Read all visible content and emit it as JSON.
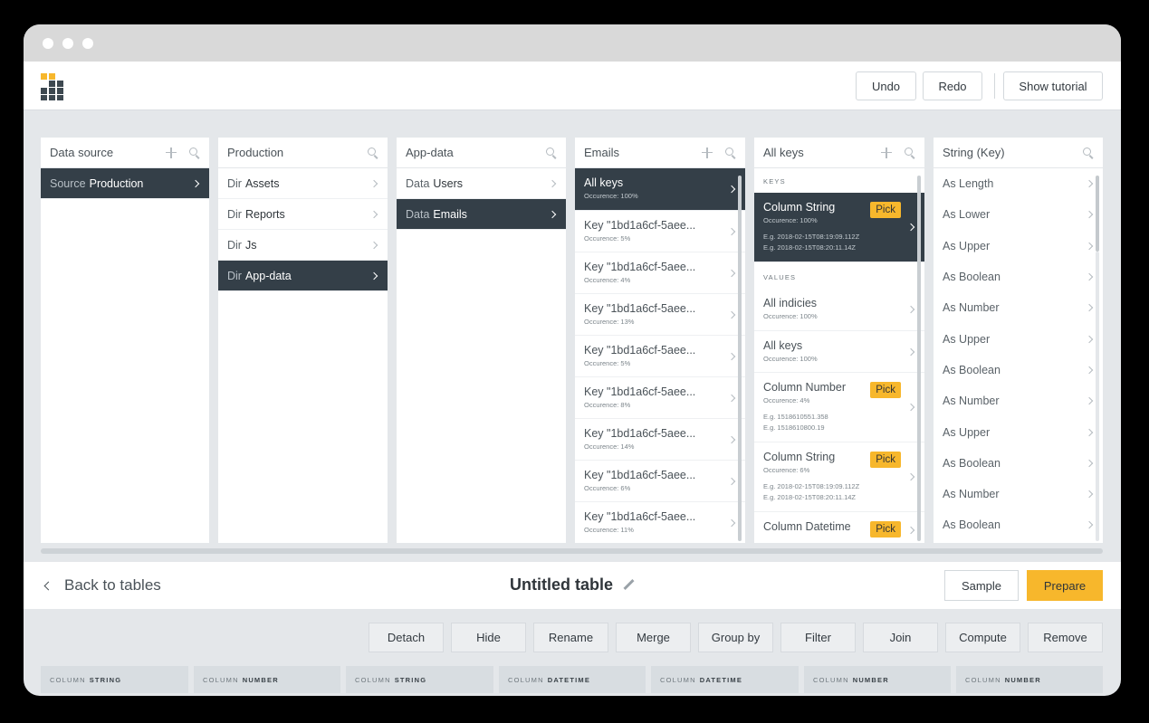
{
  "toolbar": {
    "undo": "Undo",
    "redo": "Redo",
    "tutorial": "Show tutorial"
  },
  "colors": {
    "accent": "#f7b72c",
    "active_row": "#343f48",
    "logo_dark": "#3d4850"
  },
  "columns": [
    {
      "title": "Data source",
      "rows": [
        {
          "prefix": "Source",
          "name": "Production",
          "active": true
        }
      ]
    },
    {
      "title": "Production",
      "rows": [
        {
          "prefix": "Dir",
          "name": "Assets"
        },
        {
          "prefix": "Dir",
          "name": "Reports"
        },
        {
          "prefix": "Dir",
          "name": "Js"
        },
        {
          "prefix": "Dir",
          "name": "App-data",
          "active": true
        }
      ]
    },
    {
      "title": "App-data",
      "rows": [
        {
          "prefix": "Data",
          "name": "Users"
        },
        {
          "prefix": "Data",
          "name": "Emails",
          "active": true
        }
      ]
    },
    {
      "title": "Emails",
      "rows": [
        {
          "main": "All keys",
          "occ": "Occurence: 100%",
          "active": true
        },
        {
          "main": "Key \"1bd1a6cf-5aee...",
          "occ": "Occurence: 5%"
        },
        {
          "main": "Key \"1bd1a6cf-5aee...",
          "occ": "Occurence: 4%"
        },
        {
          "main": "Key \"1bd1a6cf-5aee...",
          "occ": "Occurence: 13%"
        },
        {
          "main": "Key \"1bd1a6cf-5aee...",
          "occ": "Occurence: 5%"
        },
        {
          "main": "Key \"1bd1a6cf-5aee...",
          "occ": "Occurence: 8%"
        },
        {
          "main": "Key \"1bd1a6cf-5aee...",
          "occ": "Occurence: 14%"
        },
        {
          "main": "Key \"1bd1a6cf-5aee...",
          "occ": "Occurence: 6%"
        },
        {
          "main": "Key \"1bd1a6cf-5aee...",
          "occ": "Occurence: 11%"
        }
      ]
    },
    {
      "title": "All keys",
      "keys_label": "KEYS",
      "values_label": "VALUES",
      "pick_label": "Pick",
      "key_rows": [
        {
          "prefix": "Column",
          "name": "String",
          "occ": "Occurence: 100%",
          "eg1": "E.g. 2018-02-15T08:19:09.112Z",
          "eg2": "E.g. 2018-02-15T08:20:11.14Z",
          "pick": true,
          "active": true
        }
      ],
      "value_rows": [
        {
          "main": "All indicies",
          "occ": "Occurence: 100%"
        },
        {
          "main": "All keys",
          "occ": "Occurence: 100%"
        },
        {
          "main": "Column Number",
          "occ": "Occurence: 4%",
          "eg1": "E.g. 1518610551.358",
          "eg2": "E.g. 1518610800.19",
          "pick": true
        },
        {
          "main": "Column String",
          "occ": "Occurence: 6%",
          "eg1": "E.g. 2018-02-15T08:19:09.112Z",
          "eg2": "E.g. 2018-02-15T08:20:11.14Z",
          "pick": true
        },
        {
          "main": "Column Datetime",
          "pick": true
        }
      ]
    },
    {
      "title": "String (Key)",
      "rows": [
        "As Length",
        "As Lower",
        "As Upper",
        "As Boolean",
        "As Number",
        "As Upper",
        "As Boolean",
        "As Number",
        "As Upper",
        "As Boolean",
        "As Number",
        "As Boolean"
      ]
    }
  ],
  "bottom": {
    "back": "Back to tables",
    "table_title": "Untitled table",
    "sample": "Sample",
    "prepare": "Prepare"
  },
  "actions": [
    "Detach",
    "Hide",
    "Rename",
    "Merge",
    "Group by",
    "Filter",
    "Join",
    "Compute",
    "Remove"
  ],
  "table_columns": [
    {
      "label": "COLUMN",
      "type": "STRING"
    },
    {
      "label": "COLUMN",
      "type": "NUMBER"
    },
    {
      "label": "COLUMN",
      "type": "STRING"
    },
    {
      "label": "COLUMN",
      "type": "DATETIME"
    },
    {
      "label": "COLUMN",
      "type": "DATETIME"
    },
    {
      "label": "COLUMN",
      "type": "NUMBER"
    },
    {
      "label": "COLUMN",
      "type": "NUMBER"
    }
  ]
}
